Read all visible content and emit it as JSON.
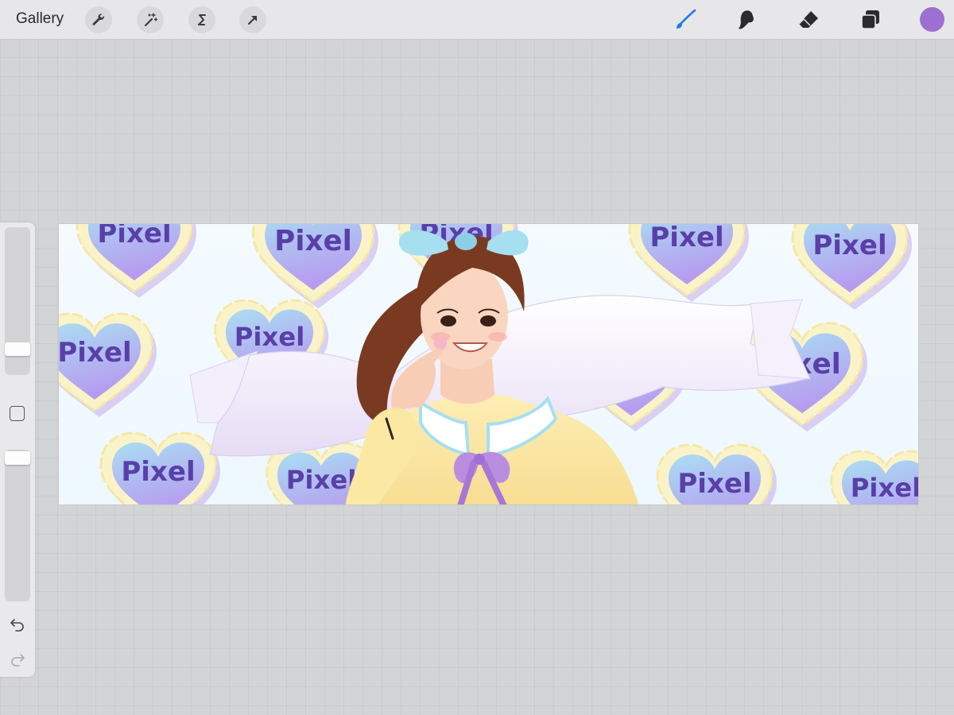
{
  "toolbar": {
    "gallery_label": "Gallery",
    "left_tools": [
      {
        "name": "actions",
        "icon": "wrench-icon"
      },
      {
        "name": "adjustments",
        "icon": "magic-wand-icon"
      },
      {
        "name": "selection",
        "icon": "selection-s-icon"
      },
      {
        "name": "transform",
        "icon": "arrow-cursor-icon"
      }
    ],
    "right_tools": [
      {
        "name": "brush",
        "icon": "brush-icon",
        "active": true,
        "color": "#1a7fe0"
      },
      {
        "name": "smudge",
        "icon": "smudge-icon"
      },
      {
        "name": "eraser",
        "icon": "eraser-icon"
      },
      {
        "name": "layers",
        "icon": "layers-icon"
      }
    ],
    "current_color": "#9c6fd0"
  },
  "sidebar": {
    "brush_size_level": 0.81,
    "opacity_level": 1.0,
    "modify_icon": "square-icon",
    "undo_icon": "undo-icon",
    "redo_icon": "redo-icon"
  },
  "canvas": {
    "hearts": [
      {
        "text": "Pixel"
      },
      {
        "text": "Pixel"
      },
      {
        "text": "Pixel"
      },
      {
        "text": "Pixel"
      },
      {
        "text": "Pixel"
      },
      {
        "text": "Pixel"
      },
      {
        "text": "Pixel"
      },
      {
        "text": "Pixel"
      },
      {
        "text": "Pixel"
      },
      {
        "text": "Pixel"
      },
      {
        "text": "Pixel"
      },
      {
        "text": "Pixel"
      },
      {
        "text": "Pixel"
      }
    ],
    "colors": {
      "heart_fill_top": "#a9dff2",
      "heart_fill_bottom": "#b79af0",
      "heart_border": "#fbf3c8",
      "heart_text": "#5a3fa8",
      "hair": "#7a3a22",
      "bow": "#a6dff0",
      "sweater": "#fbe9a6",
      "ribbon": "#b98ee0"
    }
  }
}
